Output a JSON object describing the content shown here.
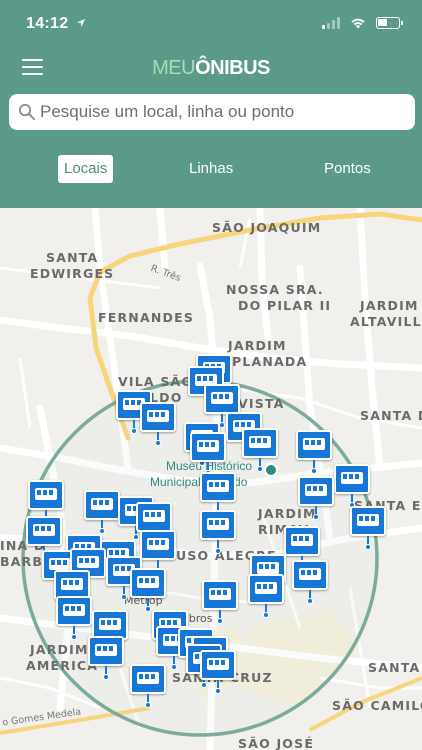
{
  "status": {
    "time": "14:12"
  },
  "header": {
    "logo_part1": "MEU",
    "logo_part2": "ÔNIBUS",
    "menu_icon": "hamburger-menu-icon"
  },
  "search": {
    "placeholder": "Pesquise um local, linha ou ponto"
  },
  "tabs": [
    {
      "label": "Locais",
      "active": true
    },
    {
      "label": "Linhas",
      "active": false
    },
    {
      "label": "Pontos",
      "active": false
    }
  ],
  "map": {
    "neighborhoods": [
      "SÃO JOAQUIM",
      "SANTA",
      "EDWIRGES",
      "NOSSA SRA.",
      "DO PILAR II",
      "JARDIM",
      "ALTAVILLE",
      "FERNANDES",
      "JARDIM",
      "PLANADA",
      "VILA SÃO",
      "LDO",
      "VISTA",
      "SANTA D",
      "JARDIM",
      "RIMAV",
      "SANTA ELISA",
      "INA D",
      "BARB",
      "USO ALEGRE",
      "JARDIM",
      "AMERICA",
      "SANTA CRUZ",
      "SANTA",
      "SÃO CAMILO",
      "SÃO JOSÉ"
    ],
    "streets": [
      "R. Três",
      "o Gomes Medela"
    ],
    "poi": {
      "line1": "Museu Histórico",
      "line2": "Municipal Tua    edo"
    },
    "area_label": "Metrop",
    "area_label_2": "mbros",
    "colors": {
      "bus_pin": "#1677d6",
      "radius_circle": "#7aab9c",
      "header": "#5b9a89"
    },
    "bus_stop_count_visible": 43
  }
}
